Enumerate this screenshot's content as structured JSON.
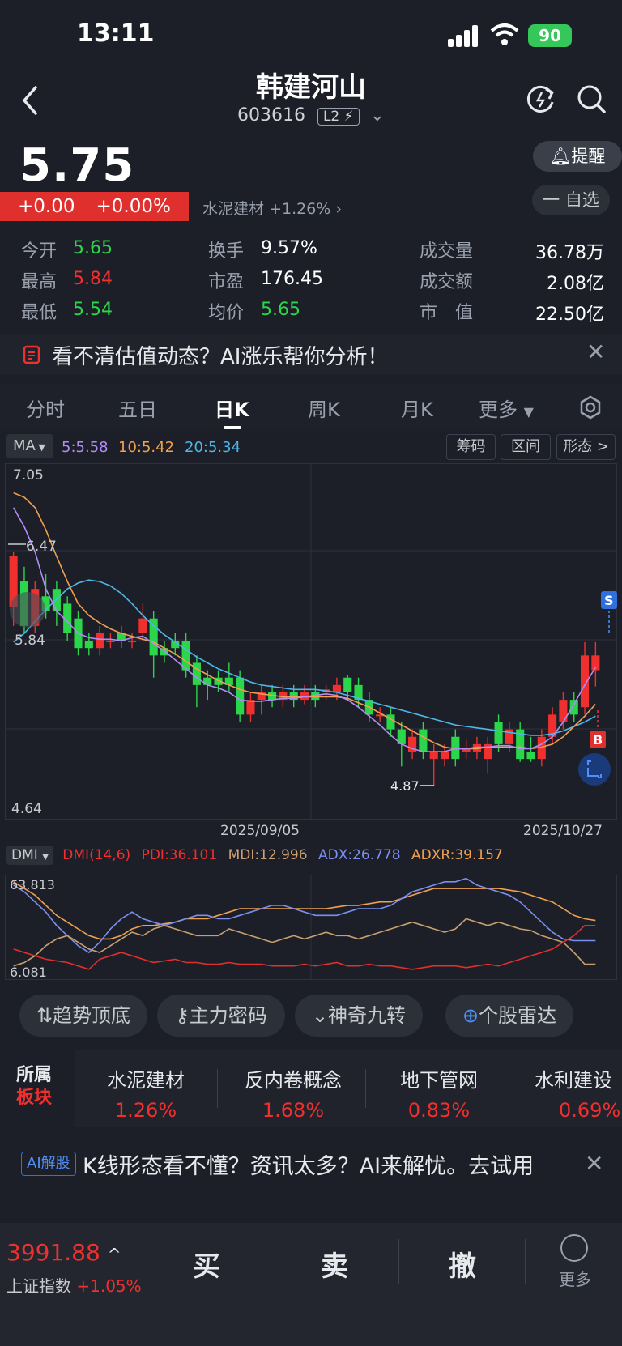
{
  "status_bar": {
    "time": "13:11",
    "battery": "90"
  },
  "header": {
    "title": "韩建河山",
    "code": "603616",
    "level_badge": "L2"
  },
  "quote": {
    "price": "5.75",
    "change": "+0.00",
    "change_pct": "+0.00%",
    "sector_name": "水泥建材",
    "sector_change": "+1.26%",
    "alert_label": "提醒",
    "watch_label": "一 自选"
  },
  "stats": {
    "open_label": "今开",
    "open": "5.65",
    "high_label": "最高",
    "high": "5.84",
    "low_label": "最低",
    "low": "5.54",
    "turnover_label": "换手",
    "turnover": "9.57%",
    "pe_label": "市盈",
    "pe": "176.45",
    "avg_label": "均价",
    "avg": "5.65",
    "volume_label": "成交量",
    "volume": "36.78万",
    "amount_label": "成交额",
    "amount": "2.08亿",
    "mcap_label": "市　值",
    "mcap": "22.50亿"
  },
  "ai_banner": {
    "text": "看不清估值动态？AI涨乐帮你分析！"
  },
  "tabs": [
    "分时",
    "五日",
    "日K",
    "周K",
    "月K",
    "更多"
  ],
  "ma_row": {
    "selector": "MA",
    "ma5": "5:5.58",
    "ma10": "10:5.42",
    "ma20": "20:5.34",
    "buttons": [
      "筹码",
      "区间",
      "形态 >"
    ]
  },
  "kline": {
    "y_top": "7.05",
    "y_mid": "6.47",
    "y_cross": "5.84",
    "y_bottom": "4.64",
    "low_mark": "4.87",
    "sell_mark": "S",
    "buy_mark": "B",
    "date_left": "2025/09/05",
    "date_right": "2025/10/27"
  },
  "dmi": {
    "selector": "DMI",
    "params": "DMI(14,6)",
    "pdi": "PDI:36.101",
    "mdi": "MDI:12.996",
    "adx": "ADX:26.778",
    "adxr": "ADXR:39.157",
    "y_top": "63.813",
    "y_bottom": "6.081"
  },
  "tools": [
    "趋势顶底",
    "主力密码",
    "神奇九转",
    "个股雷达"
  ],
  "sectors": {
    "title_line1": "所属",
    "title_line2": "板块",
    "items": [
      {
        "name": "水泥建材",
        "pct": "1.26%"
      },
      {
        "name": "反内卷概念",
        "pct": "1.68%"
      },
      {
        "name": "地下管网",
        "pct": "0.83%"
      },
      {
        "name": "水利建设",
        "pct": "0.69%"
      }
    ]
  },
  "ai_row": {
    "tag": "AI解股",
    "text": "K线形态看不懂？资讯太多？AI来解忧。去试用"
  },
  "bottom_bar": {
    "index_value": "3991.88",
    "index_name": "上证指数",
    "index_change": "+1.05%",
    "buy": "买",
    "sell": "卖",
    "cancel": "撤",
    "more": "更多"
  },
  "colors": {
    "up": "#f0302e",
    "down": "#2bd64a",
    "ma5": "#b08cf5",
    "ma10": "#f0a050",
    "ma20": "#4fb6e8",
    "background": "#1c1f27"
  },
  "chart_data": {
    "type": "candlestick",
    "title": "",
    "ylim": [
      4.64,
      7.05
    ],
    "x_labels": [
      "2025/09/05",
      "2025/10/27"
    ],
    "candles": [
      {
        "o": 6.08,
        "c": 6.42,
        "h": 6.45,
        "l": 5.95
      },
      {
        "o": 6.25,
        "c": 5.95,
        "h": 6.35,
        "l": 5.9
      },
      {
        "o": 5.95,
        "c": 6.2,
        "h": 6.25,
        "l": 5.9
      },
      {
        "o": 6.15,
        "c": 6.05,
        "h": 6.3,
        "l": 6.0
      },
      {
        "o": 6.2,
        "c": 6.05,
        "h": 6.25,
        "l": 5.95
      },
      {
        "o": 6.1,
        "c": 5.9,
        "h": 6.15,
        "l": 5.85
      },
      {
        "o": 6.0,
        "c": 5.8,
        "h": 6.05,
        "l": 5.75
      },
      {
        "o": 5.85,
        "c": 5.8,
        "h": 5.9,
        "l": 5.75
      },
      {
        "o": 5.8,
        "c": 5.9,
        "h": 5.95,
        "l": 5.75
      },
      {
        "o": 5.85,
        "c": 5.85,
        "h": 5.9,
        "l": 5.8
      },
      {
        "o": 5.9,
        "c": 5.85,
        "h": 5.95,
        "l": 5.8
      },
      {
        "o": 5.85,
        "c": 5.85,
        "h": 5.9,
        "l": 5.8
      },
      {
        "o": 5.9,
        "c": 6.0,
        "h": 6.1,
        "l": 5.85
      },
      {
        "o": 6.0,
        "c": 5.75,
        "h": 6.05,
        "l": 5.6
      },
      {
        "o": 5.8,
        "c": 5.75,
        "h": 5.85,
        "l": 5.7
      },
      {
        "o": 5.85,
        "c": 5.8,
        "h": 5.9,
        "l": 5.75
      },
      {
        "o": 5.85,
        "c": 5.65,
        "h": 5.9,
        "l": 5.6
      },
      {
        "o": 5.7,
        "c": 5.55,
        "h": 5.75,
        "l": 5.4
      },
      {
        "o": 5.6,
        "c": 5.55,
        "h": 5.65,
        "l": 5.45
      },
      {
        "o": 5.6,
        "c": 5.55,
        "h": 5.65,
        "l": 5.5
      },
      {
        "o": 5.6,
        "c": 5.55,
        "h": 5.7,
        "l": 5.5
      },
      {
        "o": 5.6,
        "c": 5.35,
        "h": 5.65,
        "l": 5.3
      },
      {
        "o": 5.35,
        "c": 5.45,
        "h": 5.5,
        "l": 5.3
      },
      {
        "o": 5.45,
        "c": 5.5,
        "h": 5.55,
        "l": 5.35
      },
      {
        "o": 5.5,
        "c": 5.45,
        "h": 5.55,
        "l": 5.4
      },
      {
        "o": 5.45,
        "c": 5.5,
        "h": 5.55,
        "l": 5.4
      },
      {
        "o": 5.5,
        "c": 5.45,
        "h": 5.55,
        "l": 5.4
      },
      {
        "o": 5.45,
        "c": 5.5,
        "h": 5.55,
        "l": 5.42
      },
      {
        "o": 5.5,
        "c": 5.45,
        "h": 5.55,
        "l": 5.4
      },
      {
        "o": 5.5,
        "c": 5.52,
        "h": 5.55,
        "l": 5.45
      },
      {
        "o": 5.5,
        "c": 5.55,
        "h": 5.6,
        "l": 5.45
      },
      {
        "o": 5.6,
        "c": 5.5,
        "h": 5.62,
        "l": 5.45
      },
      {
        "o": 5.55,
        "c": 5.45,
        "h": 5.6,
        "l": 5.4
      },
      {
        "o": 5.45,
        "c": 5.35,
        "h": 5.5,
        "l": 5.3
      },
      {
        "o": 5.35,
        "c": 5.35,
        "h": 5.4,
        "l": 5.3
      },
      {
        "o": 5.35,
        "c": 5.25,
        "h": 5.4,
        "l": 5.2
      },
      {
        "o": 5.25,
        "c": 5.15,
        "h": 5.3,
        "l": 5.0
      },
      {
        "o": 5.1,
        "c": 5.2,
        "h": 5.25,
        "l": 5.05
      },
      {
        "o": 5.25,
        "c": 5.1,
        "h": 5.3,
        "l": 5.05
      },
      {
        "o": 5.05,
        "c": 5.1,
        "h": 5.15,
        "l": 4.87
      },
      {
        "o": 5.05,
        "c": 5.1,
        "h": 5.15,
        "l": 5.0
      },
      {
        "o": 5.2,
        "c": 5.05,
        "h": 5.25,
        "l": 5.0
      },
      {
        "o": 5.1,
        "c": 5.12,
        "h": 5.18,
        "l": 5.05
      },
      {
        "o": 5.1,
        "c": 5.15,
        "h": 5.2,
        "l": 5.05
      },
      {
        "o": 5.05,
        "c": 5.15,
        "h": 5.2,
        "l": 4.95
      },
      {
        "o": 5.3,
        "c": 5.15,
        "h": 5.35,
        "l": 5.1
      },
      {
        "o": 5.15,
        "c": 5.25,
        "h": 5.3,
        "l": 5.1
      },
      {
        "o": 5.25,
        "c": 5.05,
        "h": 5.3,
        "l": 5.03
      },
      {
        "o": 5.1,
        "c": 5.05,
        "h": 5.2,
        "l": 5.03
      },
      {
        "o": 5.05,
        "c": 5.2,
        "h": 5.25,
        "l": 5.0
      },
      {
        "o": 5.2,
        "c": 5.35,
        "h": 5.4,
        "l": 5.15
      },
      {
        "o": 5.3,
        "c": 5.45,
        "h": 5.5,
        "l": 5.25
      },
      {
        "o": 5.45,
        "c": 5.35,
        "h": 5.5,
        "l": 5.3
      },
      {
        "o": 5.4,
        "c": 5.75,
        "h": 5.84,
        "l": 5.35
      },
      {
        "o": 5.65,
        "c": 5.75,
        "h": 5.84,
        "l": 5.54
      }
    ],
    "ma5": [
      6.75,
      6.62,
      6.45,
      6.2,
      6.05,
      5.98,
      5.9,
      5.87,
      5.86,
      5.86,
      5.85,
      5.87,
      5.88,
      5.83,
      5.78,
      5.72,
      5.66,
      5.6,
      5.55,
      5.53,
      5.5,
      5.45,
      5.44,
      5.44,
      5.45,
      5.46,
      5.46,
      5.47,
      5.48,
      5.49,
      5.48,
      5.45,
      5.4,
      5.34,
      5.28,
      5.21,
      5.15,
      5.12,
      5.1,
      5.1,
      5.1,
      5.12,
      5.12,
      5.13,
      5.13,
      5.14,
      5.14,
      5.12,
      5.12,
      5.15,
      5.2,
      5.3,
      5.42,
      5.55,
      5.67
    ],
    "ma10": [
      6.85,
      6.82,
      6.75,
      6.6,
      6.42,
      6.25,
      6.1,
      6.02,
      5.97,
      5.93,
      5.9,
      5.88,
      5.86,
      5.84,
      5.8,
      5.76,
      5.71,
      5.66,
      5.62,
      5.58,
      5.55,
      5.52,
      5.5,
      5.49,
      5.48,
      5.47,
      5.47,
      5.47,
      5.47,
      5.47,
      5.47,
      5.46,
      5.43,
      5.4,
      5.36,
      5.32,
      5.28,
      5.24,
      5.2,
      5.16,
      5.13,
      5.12,
      5.12,
      5.12,
      5.13,
      5.13,
      5.13,
      5.13,
      5.12,
      5.13,
      5.15,
      5.2,
      5.27,
      5.34,
      5.42
    ],
    "ma20": [
      5.84,
      5.9,
      5.98,
      6.06,
      6.13,
      6.2,
      6.24,
      6.26,
      6.25,
      6.22,
      6.17,
      6.1,
      6.02,
      5.95,
      5.89,
      5.84,
      5.79,
      5.74,
      5.7,
      5.66,
      5.63,
      5.6,
      5.57,
      5.55,
      5.54,
      5.53,
      5.52,
      5.52,
      5.52,
      5.51,
      5.5,
      5.48,
      5.46,
      5.44,
      5.42,
      5.4,
      5.38,
      5.36,
      5.34,
      5.32,
      5.3,
      5.28,
      5.27,
      5.26,
      5.25,
      5.24,
      5.23,
      5.22,
      5.21,
      5.21,
      5.22,
      5.24,
      5.27,
      5.3,
      5.34
    ],
    "dmi_ylim": [
      6.081,
      63.813
    ],
    "dmi_pdi": [
      22,
      20,
      18,
      16,
      15,
      14,
      12,
      10,
      16,
      18,
      20,
      18,
      16,
      14,
      15,
      16,
      14,
      14,
      13,
      13,
      14,
      13,
      13,
      13,
      12,
      12,
      12,
      13,
      12,
      13,
      14,
      12,
      12,
      13,
      12,
      12,
      11,
      10,
      11,
      12,
      12,
      12,
      11,
      12,
      13,
      12,
      14,
      16,
      18,
      20,
      22,
      26,
      30,
      36,
      36
    ],
    "dmi_mdi": [
      12,
      14,
      18,
      24,
      28,
      30,
      26,
      22,
      20,
      24,
      28,
      32,
      30,
      34,
      36,
      34,
      32,
      30,
      30,
      30,
      34,
      32,
      30,
      28,
      26,
      28,
      30,
      28,
      30,
      32,
      30,
      30,
      28,
      30,
      32,
      34,
      36,
      38,
      36,
      34,
      32,
      34,
      40,
      38,
      36,
      38,
      36,
      34,
      33,
      30,
      28,
      26,
      20,
      13,
      13
    ],
    "dmi_adx": [
      60,
      56,
      50,
      44,
      36,
      30,
      24,
      20,
      26,
      34,
      40,
      44,
      40,
      38,
      36,
      38,
      40,
      42,
      42,
      40,
      40,
      42,
      44,
      46,
      48,
      48,
      46,
      44,
      42,
      42,
      42,
      44,
      46,
      46,
      46,
      48,
      52,
      56,
      58,
      60,
      62,
      62,
      64,
      60,
      58,
      56,
      54,
      50,
      44,
      38,
      32,
      28,
      27,
      27,
      27
    ],
    "dmi_adxr": [
      62,
      58,
      54,
      48,
      42,
      38,
      34,
      30,
      28,
      28,
      30,
      34,
      36,
      36,
      37,
      38,
      40,
      40,
      40,
      42,
      44,
      46,
      46,
      46,
      46,
      46,
      46,
      46,
      46,
      46,
      47,
      48,
      48,
      49,
      50,
      50,
      52,
      54,
      56,
      58,
      58,
      58,
      58,
      58,
      58,
      58,
      57,
      56,
      54,
      52,
      50,
      46,
      42,
      40,
      39
    ]
  }
}
